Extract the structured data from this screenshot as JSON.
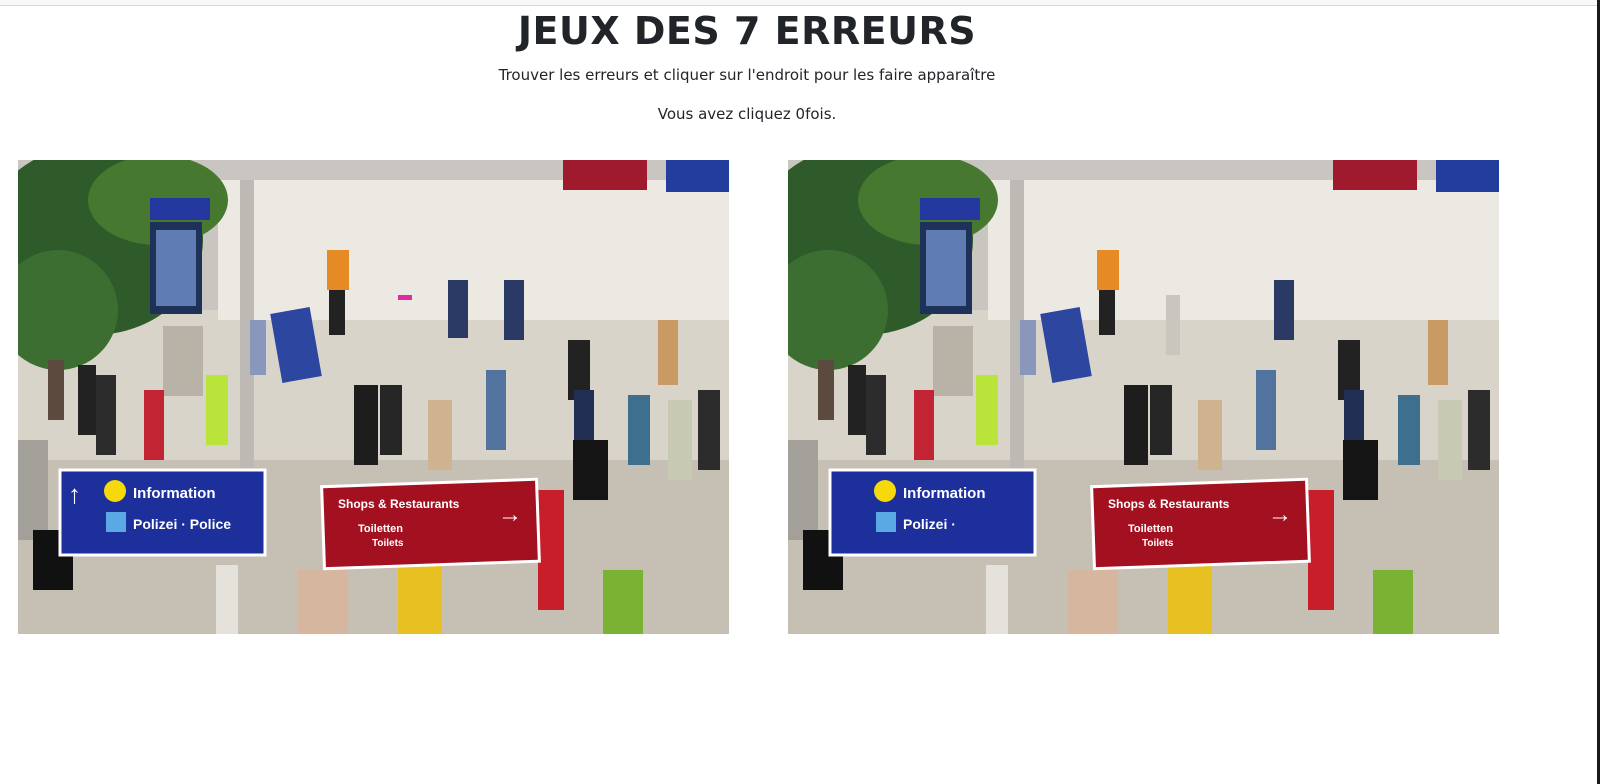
{
  "title": "JEUX DES 7 ERREURS",
  "instructions": "Trouver les erreurs et cliquer sur l'endroit pour les faire apparaître",
  "click_count": 0,
  "counter_prefix": "Vous avez cliquez ",
  "counter_suffix": "fois.",
  "signs": {
    "info": "Information",
    "police_left": "Polizei · Police",
    "police_right": "Polizei ·",
    "polizei_badge": "Polizei",
    "shops": "Shops & Restaurants",
    "toiletten": "Toiletten",
    "toilets": "Toilets"
  },
  "colors": {
    "info_sign": "#1c2f9b",
    "shops_sign": "#a3101f",
    "info_icon": "#f5d90a"
  }
}
